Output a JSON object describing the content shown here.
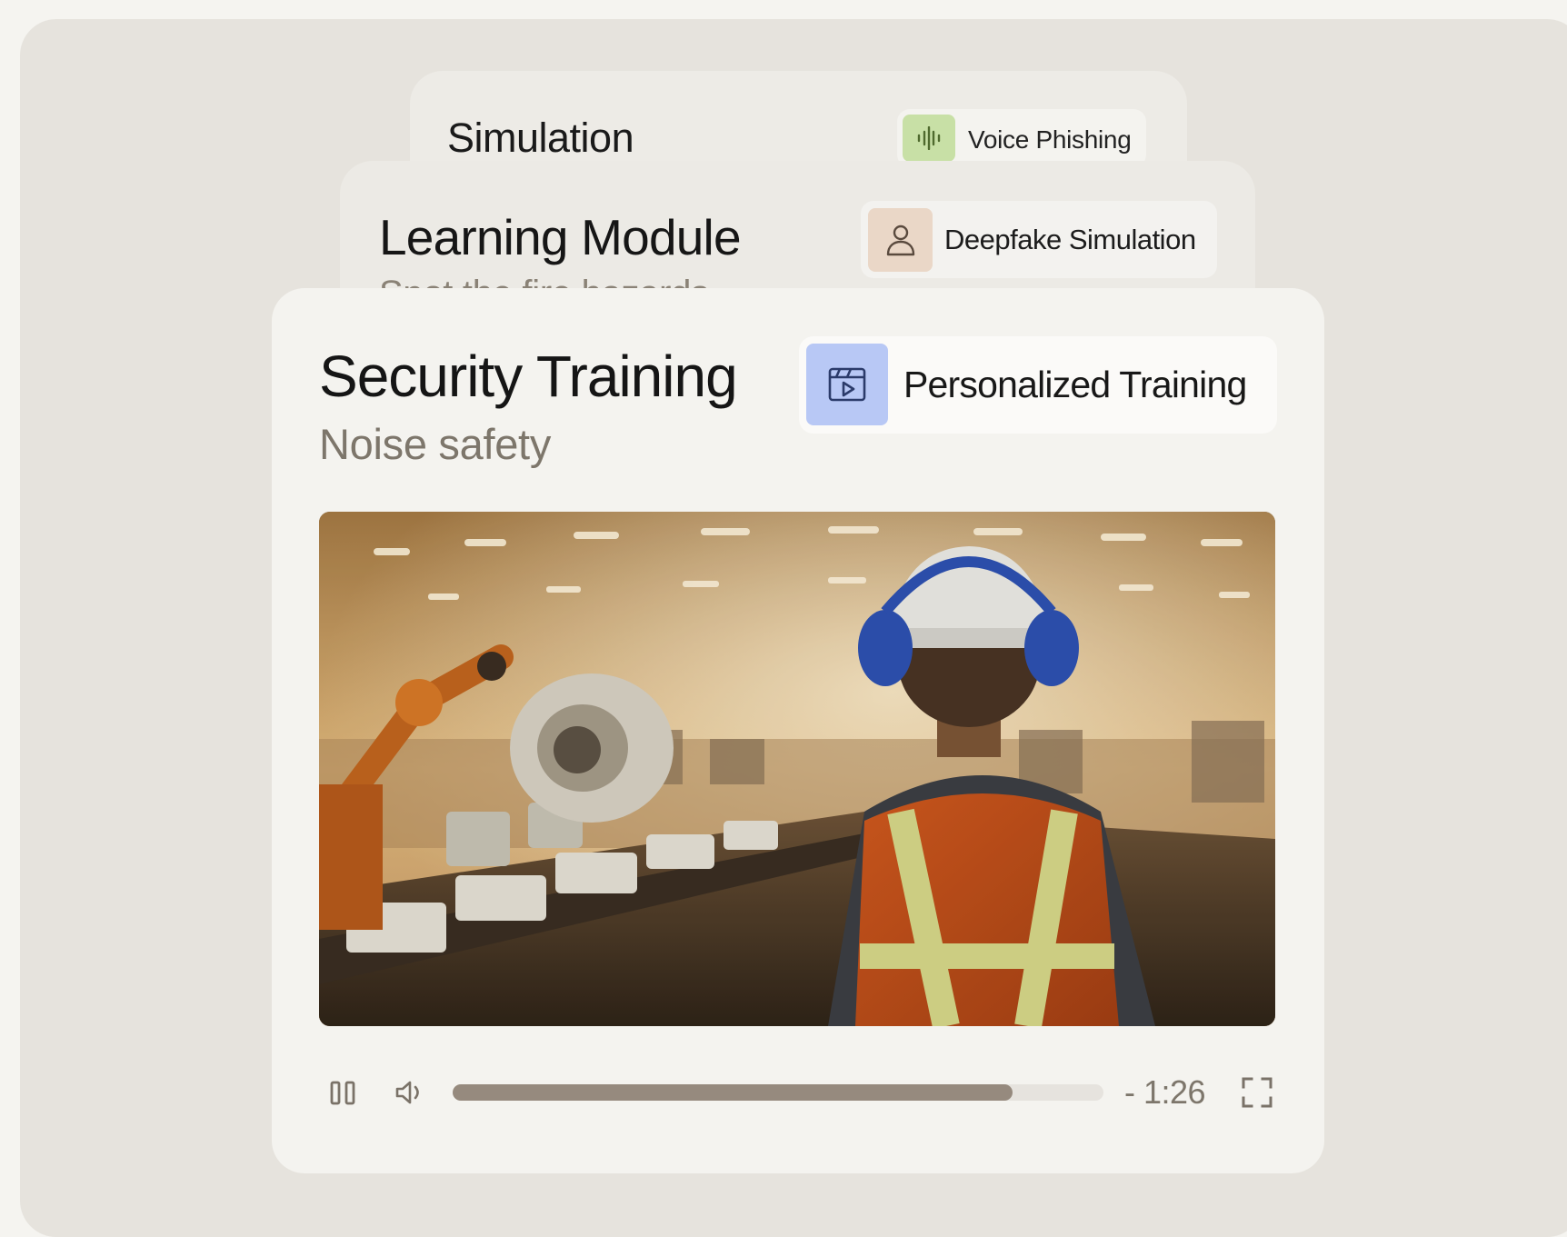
{
  "cards": {
    "simulation": {
      "title": "Simulation",
      "badge_label": "Voice Phishing",
      "badge_icon": "waveform-icon",
      "badge_color": "#c8e0a6"
    },
    "learning_module": {
      "title": "Learning Module",
      "subtitle": "Spot the fire hazards",
      "badge_label": "Deepfake Simulation",
      "badge_icon": "person-icon",
      "badge_color": "#ead7c7"
    },
    "security_training": {
      "title": "Security Training",
      "subtitle": "Noise safety",
      "badge_label": "Personalized Training",
      "badge_icon": "video-icon",
      "badge_color": "#b8c8f5"
    }
  },
  "player": {
    "progress_fraction": 0.86,
    "time_remaining": "- 1:26",
    "pause_icon": "pause-icon",
    "volume_icon": "volume-icon",
    "fullscreen_icon": "fullscreen-icon"
  }
}
